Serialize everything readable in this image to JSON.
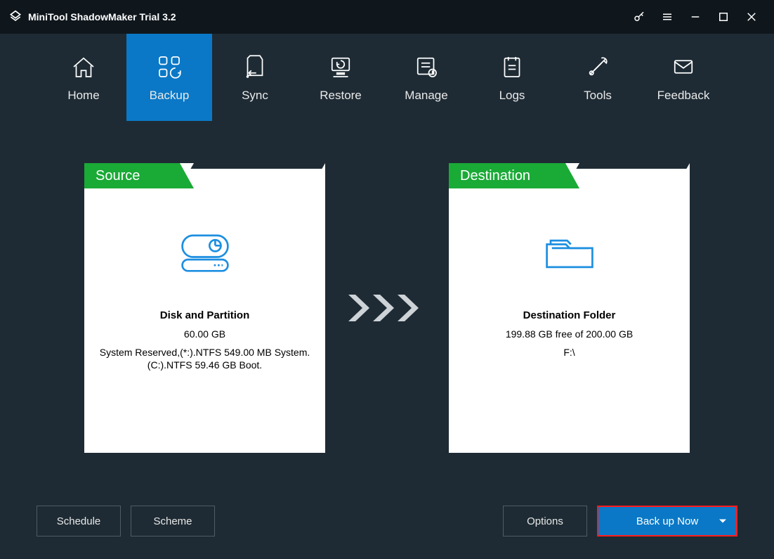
{
  "title": "MiniTool ShadowMaker Trial 3.2",
  "nav": {
    "home": "Home",
    "backup": "Backup",
    "sync": "Sync",
    "restore": "Restore",
    "manage": "Manage",
    "logs": "Logs",
    "tools": "Tools",
    "feedback": "Feedback"
  },
  "source": {
    "tab": "Source",
    "title": "Disk and Partition",
    "size": "60.00 GB",
    "detail1": "System Reserved,(*:).NTFS 549.00 MB System.",
    "detail2": "(C:).NTFS 59.46 GB Boot."
  },
  "destination": {
    "tab": "Destination",
    "title": "Destination Folder",
    "free": "199.88 GB free of 200.00 GB",
    "path": "F:\\"
  },
  "footer": {
    "schedule": "Schedule",
    "scheme": "Scheme",
    "options": "Options",
    "backup_now": "Back up Now"
  }
}
